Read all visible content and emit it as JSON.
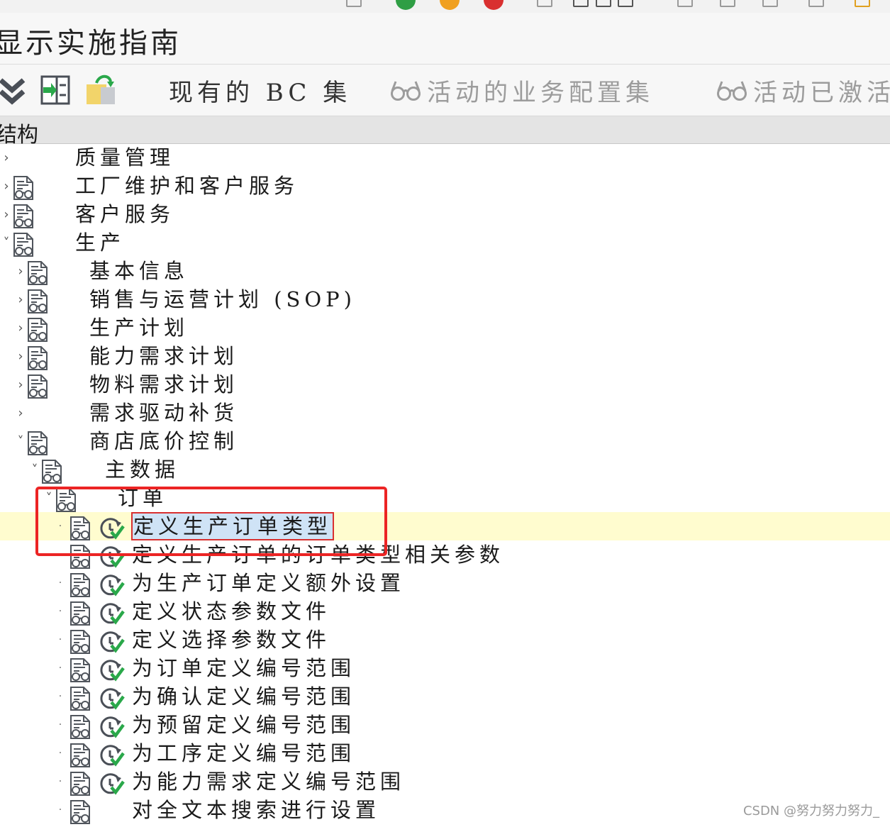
{
  "window": {
    "title": "显示实施指南"
  },
  "toolbar": {
    "existing_bc_sets": "现有的 BC 集",
    "active_bc_sets": "活动的业务配置集",
    "activated_bc_sets": "活动已激活"
  },
  "column_header": "结构",
  "tree": [
    {
      "label": "质量管理",
      "level": 0,
      "state": "collapsed",
      "doc_icon": false,
      "exec_icon": false
    },
    {
      "label": "工厂维护和客户服务",
      "level": 0,
      "state": "collapsed",
      "doc_icon": true,
      "exec_icon": false
    },
    {
      "label": "客户服务",
      "level": 0,
      "state": "collapsed",
      "doc_icon": true,
      "exec_icon": false
    },
    {
      "label": "生产",
      "level": 0,
      "state": "expanded",
      "doc_icon": true,
      "exec_icon": false
    },
    {
      "label": "基本信息",
      "level": 1,
      "state": "collapsed",
      "doc_icon": true,
      "exec_icon": false
    },
    {
      "label": "销售与运营计划 (SOP)",
      "level": 1,
      "state": "collapsed",
      "doc_icon": true,
      "exec_icon": false
    },
    {
      "label": "生产计划",
      "level": 1,
      "state": "collapsed",
      "doc_icon": true,
      "exec_icon": false
    },
    {
      "label": "能力需求计划",
      "level": 1,
      "state": "collapsed",
      "doc_icon": true,
      "exec_icon": false
    },
    {
      "label": "物料需求计划",
      "level": 1,
      "state": "collapsed",
      "doc_icon": true,
      "exec_icon": false
    },
    {
      "label": "需求驱动补货",
      "level": 1,
      "state": "collapsed",
      "doc_icon": false,
      "exec_icon": false
    },
    {
      "label": "商店底价控制",
      "level": 1,
      "state": "expanded",
      "doc_icon": true,
      "exec_icon": false
    },
    {
      "label": "主数据",
      "level": 2,
      "state": "expanded",
      "doc_icon": true,
      "exec_icon": false
    },
    {
      "label": "订单",
      "level": 3,
      "state": "expanded",
      "doc_icon": true,
      "exec_icon": false
    },
    {
      "label": "定义生产订单类型",
      "level": 4,
      "state": "leaf",
      "doc_icon": true,
      "exec_icon": true,
      "selected": true
    },
    {
      "label": "定义生产订单的订单类型相关参数",
      "level": 4,
      "state": "leaf",
      "doc_icon": true,
      "exec_icon": true
    },
    {
      "label": "为生产订单定义额外设置",
      "level": 4,
      "state": "leaf",
      "doc_icon": true,
      "exec_icon": true
    },
    {
      "label": "定义状态参数文件",
      "level": 4,
      "state": "leaf",
      "doc_icon": true,
      "exec_icon": true
    },
    {
      "label": "定义选择参数文件",
      "level": 4,
      "state": "leaf",
      "doc_icon": true,
      "exec_icon": true
    },
    {
      "label": "为订单定义编号范围",
      "level": 4,
      "state": "leaf",
      "doc_icon": true,
      "exec_icon": true
    },
    {
      "label": "为确认定义编号范围",
      "level": 4,
      "state": "leaf",
      "doc_icon": true,
      "exec_icon": true
    },
    {
      "label": "为预留定义编号范围",
      "level": 4,
      "state": "leaf",
      "doc_icon": true,
      "exec_icon": true
    },
    {
      "label": "为工序定义编号范围",
      "level": 4,
      "state": "leaf",
      "doc_icon": true,
      "exec_icon": true
    },
    {
      "label": "为能力需求定义编号范围",
      "level": 4,
      "state": "leaf",
      "doc_icon": true,
      "exec_icon": true
    },
    {
      "label": "对全文本搜索进行设置",
      "level": 4,
      "state": "leaf",
      "doc_icon": true,
      "exec_icon": false
    }
  ],
  "watermark": "CSDN @努力努力努力_",
  "colors": {
    "selected_row": "#fffccf",
    "highlight_box": "#ec2424",
    "check_green": "#2aa84a",
    "toolbar_bg": "#f7f7f7",
    "header_bg": "#e4e4e4"
  }
}
